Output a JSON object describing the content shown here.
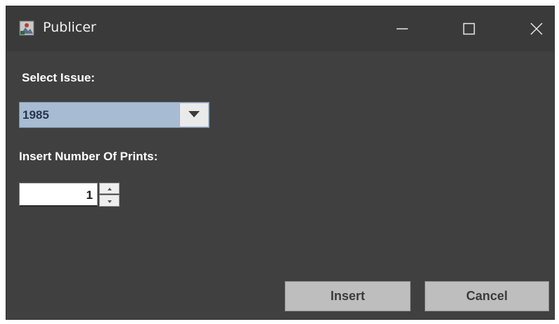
{
  "window": {
    "title": "Publicer",
    "icons": {
      "app": "app-icon",
      "minimize": "minimize-icon",
      "maximize": "maximize-icon",
      "close": "close-icon"
    }
  },
  "form": {
    "issue_label": "Select Issue:",
    "issue_value": "1985",
    "prints_label": "Insert Number Of Prints:",
    "prints_value": "1"
  },
  "buttons": {
    "insert": "Insert",
    "cancel": "Cancel"
  },
  "colors": {
    "window_bg": "#404040",
    "titlebar_bg": "#3a3a3a",
    "combo_bg": "#a7bcd2",
    "button_bg": "#bebebe"
  }
}
